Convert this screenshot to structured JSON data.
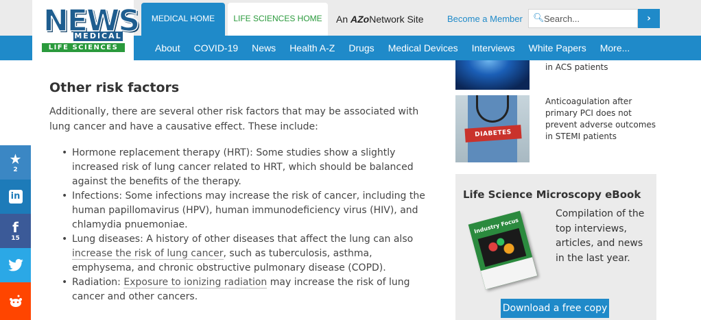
{
  "header": {
    "logo": {
      "news": "NEWS",
      "medical": "MEDICAL",
      "life_sciences": "LIFE SCIENCES"
    },
    "tabs": [
      {
        "label": "MEDICAL HOME"
      },
      {
        "label": "LIFE SCIENCES HOME"
      }
    ],
    "network_prefix": "An",
    "network_brand": "AZo",
    "network_suffix": "Network Site",
    "become_member": "Become a Member",
    "search": {
      "placeholder": "Search...",
      "icon": "search-icon",
      "button_icon": "chevron-right-icon"
    }
  },
  "nav": {
    "items": [
      "About",
      "COVID-19",
      "News",
      "Health A-Z",
      "Drugs",
      "Medical Devices",
      "Interviews",
      "White Papers",
      "More..."
    ]
  },
  "article": {
    "heading": "Other risk factors",
    "intro": "Additionally, there are several other risk factors that may be associated with lung cancer and have a causative effect. These include:",
    "bullets": {
      "hrt": "Hormone replacement therapy (HRT): Some studies show a slightly increased risk of lung cancer related to HRT, which should be balanced against the benefits of the therapy.",
      "infections": "Infections: Some infections may increase the risk of cancer, including the human papillomavirus (HPV), human immunodeficiency virus (HIV), and chlamydia pnuemoniae.",
      "lung_pre": "Lung diseases: A history of other diseases that affect the lung can also ",
      "lung_link": "increase the risk of lung cancer",
      "lung_post": ", such as tuberculosis, asthma, emphysema, and chronic obstructive pulmonary disease (COPD).",
      "rad_pre": "Radiation: ",
      "rad_link": "Exposure to ionizing radiation",
      "rad_post": " may increase the risk of lung cancer and other cancers."
    }
  },
  "share": {
    "star_count": "2",
    "facebook_count": "15",
    "icons": [
      "star-icon",
      "linkedin-icon",
      "facebook-icon",
      "twitter-icon",
      "reddit-icon"
    ]
  },
  "sidebar": {
    "news": [
      {
        "title": "in ACS patients"
      },
      {
        "title": "Anticoagulation after primary PCI does not prevent adverse outcomes in STEMI patients",
        "image_text": "DIABETES"
      }
    ],
    "ebook": {
      "title": "Life Science Microscopy eBook",
      "description": "Compilation of the top interviews, articles, and news in the last year.",
      "cover_text": "Industry Focus",
      "button": "Download a free copy"
    }
  },
  "colors": {
    "brand_blue": "#1f8ac9",
    "brand_green": "#2a9a3c",
    "facebook": "#3b5a98",
    "twitter": "#2ba8e6",
    "reddit": "#ff4500"
  }
}
